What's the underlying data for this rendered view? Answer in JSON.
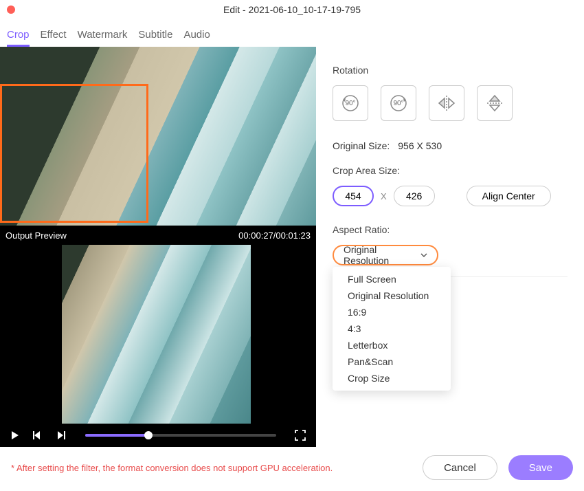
{
  "window": {
    "title": "Edit - 2021-06-10_10-17-19-795"
  },
  "tabs": [
    "Crop",
    "Effect",
    "Watermark",
    "Subtitle",
    "Audio"
  ],
  "active_tab": 0,
  "preview": {
    "label": "Output Preview",
    "timecode": "00:00:27/00:01:23"
  },
  "rotation": {
    "label": "Rotation"
  },
  "original_size": {
    "label": "Original Size:",
    "value": "956 X 530"
  },
  "crop_area": {
    "label": "Crop Area Size:",
    "w": "454",
    "h": "426",
    "align": "Align Center"
  },
  "aspect": {
    "label": "Aspect Ratio:",
    "selected": "Original Resolution",
    "options": [
      "Full Screen",
      "Original Resolution",
      "16:9",
      "4:3",
      "Letterbox",
      "Pan&Scan",
      "Crop Size"
    ]
  },
  "footer": {
    "note": "* After setting the filter, the format conversion does not support GPU acceleration.",
    "cancel": "Cancel",
    "save": "Save"
  }
}
